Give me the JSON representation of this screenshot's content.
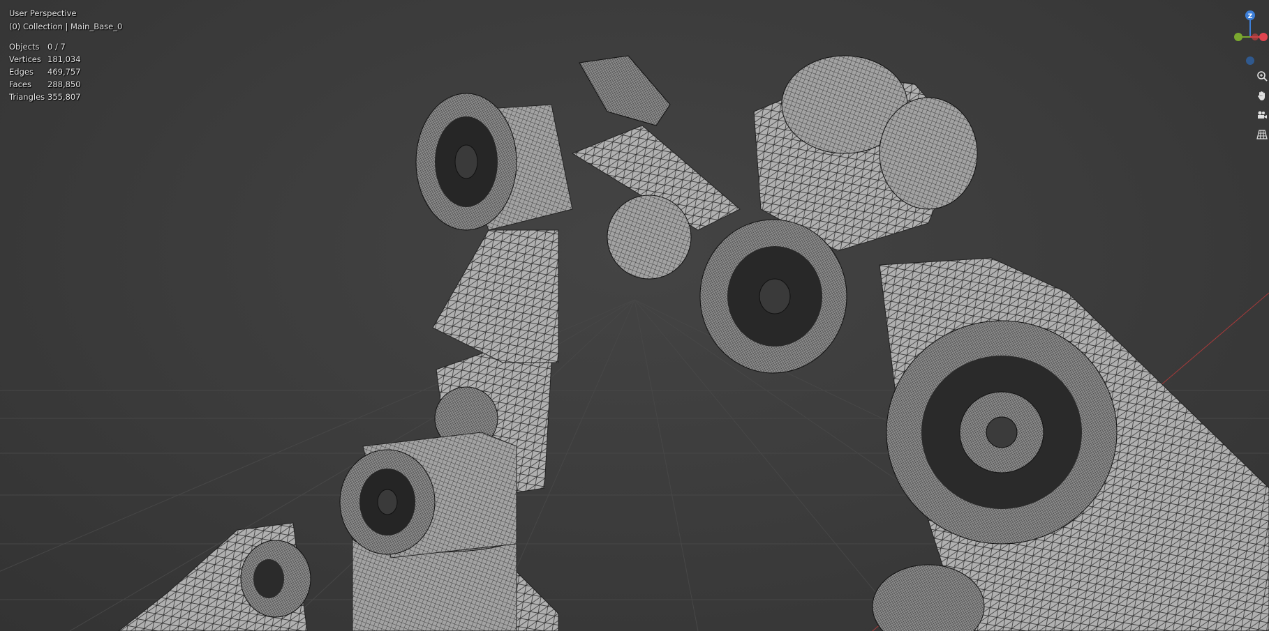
{
  "viewport": {
    "view_name": "User Perspective",
    "collection_info": "(0) Collection | Main_Base_0"
  },
  "stats": {
    "objects_label": "Objects",
    "objects_value": "0 / 7",
    "vertices_label": "Vertices",
    "vertices_value": "181,034",
    "edges_label": "Edges",
    "edges_value": "469,757",
    "faces_label": "Faces",
    "faces_value": "288,850",
    "triangles_label": "Triangles",
    "triangles_value": "355,807"
  },
  "gizmo": {
    "z_label": "Z",
    "x_color": "#e0444f",
    "y_color": "#7aa82f",
    "z_color": "#3d7fd8"
  },
  "nav_tools": [
    "zoom-icon",
    "hand-pan-icon",
    "camera-icon",
    "grid-perspective-icon"
  ],
  "colors": {
    "background": "#3a3a3a",
    "mesh_fill": "#9a9a9a",
    "wire": "#1a1a1a",
    "grid": "#4a4a4a"
  }
}
